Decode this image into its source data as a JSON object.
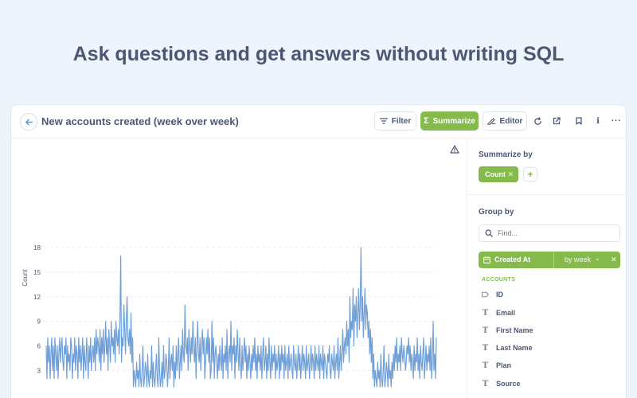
{
  "hero": {
    "heading": "Ask questions and get answers without writing SQL"
  },
  "question": {
    "title": "New accounts created (week over week)",
    "back_icon": "arrow-left-icon"
  },
  "toolbar": {
    "filter_label": "Filter",
    "summarize_label": "Summarize",
    "editor_label": "Editor",
    "filter_icon": "filter-icon",
    "summarize_icon": "sigma-icon",
    "editor_icon": "notebook-icon",
    "icons": [
      "refresh-icon",
      "share-icon",
      "bookmark-icon",
      "info-icon",
      "ellipsis-icon"
    ]
  },
  "sidebar": {
    "summarize_by": "Summarize by",
    "metric_label": "Count",
    "group_by": "Group by",
    "search_placeholder": "Find...",
    "selected_group": {
      "label": "Created At",
      "bucket": "by week"
    },
    "section_label": "ACCOUNTS",
    "fields": [
      {
        "label": "ID",
        "icon": "tag-icon"
      },
      {
        "label": "Email",
        "icon": "text-icon"
      },
      {
        "label": "First Name",
        "icon": "text-icon"
      },
      {
        "label": "Last Name",
        "icon": "text-icon"
      },
      {
        "label": "Plan",
        "icon": "text-icon"
      },
      {
        "label": "Source",
        "icon": "text-icon"
      }
    ]
  },
  "colors": {
    "accent": "#84bb4c",
    "line": "#6f9fd8",
    "text": "#4c5773",
    "background": "#eef4fc"
  },
  "chart_data": {
    "type": "line",
    "title": "",
    "xlabel": "",
    "ylabel": "Count",
    "ylim": [
      1,
      18
    ],
    "yticks": [
      3,
      6,
      9,
      12,
      15,
      18
    ],
    "grid": true,
    "warning_icon": "warning-icon",
    "series": [
      {
        "values": [
          6,
          2,
          7,
          4,
          6,
          2,
          5,
          7,
          3,
          6,
          2,
          7,
          5,
          3,
          6,
          2,
          5,
          7,
          4,
          6,
          7,
          4,
          3,
          6,
          5,
          7,
          2,
          6,
          4,
          5,
          3,
          7,
          6,
          2,
          5,
          4,
          7,
          3,
          6,
          5,
          2,
          7,
          4,
          6,
          3,
          5,
          7,
          2,
          6,
          4,
          3,
          7,
          5,
          2,
          6,
          4,
          7,
          3,
          5,
          6,
          4,
          7,
          3,
          8,
          5,
          7,
          6,
          4,
          8,
          3,
          7,
          5,
          8,
          4,
          6,
          9,
          5,
          7,
          3,
          8,
          6,
          4,
          9,
          6,
          7,
          5,
          8,
          4,
          9,
          7,
          6,
          8,
          5,
          9,
          17,
          4,
          7,
          6,
          11,
          8,
          5,
          9,
          12,
          7,
          6,
          8,
          5,
          10,
          4,
          7,
          1,
          3,
          2,
          1,
          4,
          2,
          3,
          1,
          5,
          2,
          1,
          3,
          6,
          1,
          2,
          4,
          3,
          1,
          5,
          2,
          1,
          3,
          2,
          6,
          1,
          4,
          2,
          1,
          3,
          5,
          2,
          1,
          7,
          3,
          1,
          2,
          4,
          1,
          6,
          2,
          3,
          5,
          4,
          1,
          3,
          7,
          2,
          4,
          5,
          3,
          6,
          1,
          4,
          2,
          6,
          3,
          5,
          7,
          2,
          4,
          6,
          3,
          8,
          5,
          4,
          11,
          6,
          5,
          7,
          3,
          8,
          6,
          4,
          7,
          5,
          9,
          6,
          4,
          7,
          2,
          6,
          9,
          5,
          4,
          7,
          3,
          6,
          8,
          5,
          7,
          2,
          4,
          7,
          5,
          8,
          4,
          7,
          2,
          3,
          9,
          4,
          7,
          2,
          5,
          6,
          4,
          2,
          5,
          3,
          6,
          4,
          3,
          7,
          2,
          5,
          4,
          6,
          3,
          8,
          2,
          5,
          6,
          4,
          9,
          3,
          6,
          5,
          7,
          2,
          6,
          4,
          8,
          5,
          3,
          7,
          4,
          2,
          6,
          3,
          5,
          7,
          4,
          6,
          2,
          5,
          3,
          6,
          4,
          2,
          5,
          3,
          6,
          4,
          7,
          3,
          5,
          2,
          6,
          4,
          5,
          3,
          6,
          2,
          5,
          7,
          3,
          4,
          6,
          2,
          5,
          3,
          7,
          4,
          2,
          6,
          3,
          5,
          4,
          6,
          2,
          5,
          3,
          4,
          6,
          2,
          5,
          3,
          6,
          4,
          5,
          2,
          6,
          3,
          4,
          5,
          2,
          6,
          3,
          4,
          5,
          3,
          2,
          6,
          4,
          3,
          5,
          2,
          4,
          6,
          3,
          5,
          2,
          4,
          6,
          3,
          5,
          4,
          2,
          6,
          3,
          4,
          5,
          2,
          4,
          6,
          3,
          5,
          4,
          2,
          6,
          3,
          5,
          4,
          3,
          6,
          2,
          5,
          4,
          3,
          6,
          2,
          5,
          4,
          3,
          2,
          5,
          4,
          6,
          3,
          2,
          5,
          4,
          3,
          6,
          2,
          4,
          5,
          3,
          7,
          2,
          4,
          6,
          3,
          5,
          8,
          4,
          6,
          7,
          5,
          9,
          6,
          8,
          4,
          12,
          7,
          9,
          8,
          13,
          6,
          11,
          9,
          12,
          7,
          10,
          13,
          8,
          11,
          18,
          9,
          12,
          7,
          10,
          13,
          8,
          11,
          10,
          7,
          9,
          5,
          8,
          4,
          7,
          2,
          5,
          1,
          3,
          2,
          1,
          4,
          2,
          3,
          1,
          5,
          2,
          1,
          3,
          6,
          1,
          2,
          4,
          3,
          1,
          5,
          2,
          3,
          1,
          4,
          2,
          5,
          3,
          6,
          4,
          7,
          3,
          5,
          4,
          6,
          3,
          7,
          5,
          4,
          6,
          5,
          3,
          4,
          6,
          5,
          7,
          4,
          6,
          3,
          5,
          4,
          2,
          6,
          3,
          5,
          4,
          7,
          3,
          5,
          2,
          6,
          4,
          3,
          5,
          7,
          2,
          4,
          6,
          3,
          5,
          4,
          6,
          3,
          7,
          2,
          4,
          9,
          3,
          5,
          2,
          7
        ]
      }
    ]
  }
}
